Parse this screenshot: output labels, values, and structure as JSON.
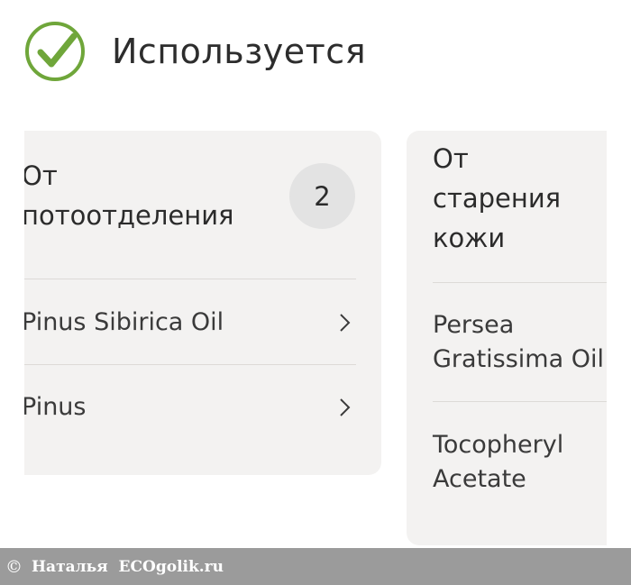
{
  "header": {
    "title": "Используется",
    "icon": "check-circle-icon",
    "icon_color": "#6fa63a"
  },
  "cards": [
    {
      "title": "От потоотделения",
      "title_lines": [
        "От",
        "потоотделения"
      ],
      "count": "2",
      "items": [
        {
          "label": "Pinus Sibirica Oil"
        },
        {
          "label": "Pinus"
        }
      ]
    },
    {
      "title": "От старения кожи",
      "title_lines": [
        "От",
        "старения",
        "кожи"
      ],
      "items": [
        {
          "label_lines": [
            "Persea",
            "Gratissima Oil"
          ]
        },
        {
          "label_lines": [
            "Tocopheryl",
            "Acetate"
          ]
        }
      ]
    }
  ],
  "footer": {
    "copyright": "©",
    "text": "Наталья  ECOgolik.ru"
  },
  "colors": {
    "card_bg": "#f3f2f1",
    "badge_bg": "#e3e3e3",
    "footer_bg": "#9b9b9b"
  }
}
